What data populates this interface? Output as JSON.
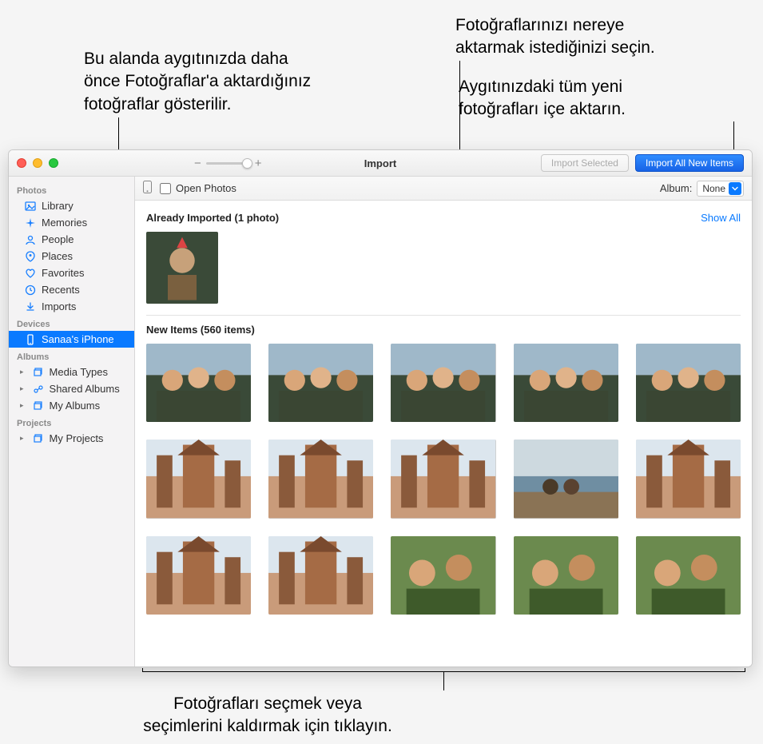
{
  "callouts": {
    "top_left": "Bu alanda aygıtınızda daha\nönce Fotoğraflar'a aktardığınız\nfotoğraflar gösterilir.",
    "top_right1": "Fotoğraflarınızı nereye\naktarmak istediğinizi seçin.",
    "top_right2": "Aygıtınızdaki tüm yeni\nfotoğrafları içe aktarın.",
    "bottom": "Fotoğrafları seçmek veya\nseçimlerini kaldırmak için tıklayın."
  },
  "toolbar": {
    "title": "Import",
    "zoom_minus": "−",
    "zoom_plus": "+",
    "import_selected": "Import Selected",
    "import_all": "Import All New Items"
  },
  "subbar": {
    "open_photos": "Open Photos",
    "album_label": "Album:",
    "album_value": "None"
  },
  "sidebar": {
    "sections": {
      "photos": "Photos",
      "devices": "Devices",
      "albums": "Albums",
      "projects": "Projects"
    },
    "photos": [
      {
        "icon": "photo",
        "label": "Library"
      },
      {
        "icon": "sparkle",
        "label": "Memories"
      },
      {
        "icon": "person",
        "label": "People"
      },
      {
        "icon": "pin",
        "label": "Places"
      },
      {
        "icon": "heart",
        "label": "Favorites"
      },
      {
        "icon": "clock",
        "label": "Recents"
      },
      {
        "icon": "download",
        "label": "Imports"
      }
    ],
    "devices": [
      {
        "icon": "phone",
        "label": "Sanaa's iPhone",
        "selected": true
      }
    ],
    "albums": [
      {
        "icon": "stack",
        "label": "Media Types",
        "chev": true
      },
      {
        "icon": "shared",
        "label": "Shared Albums",
        "chev": true
      },
      {
        "icon": "stack",
        "label": "My Albums",
        "chev": true
      }
    ],
    "projects_items": [
      {
        "icon": "stack",
        "label": "My Projects",
        "chev": true
      }
    ]
  },
  "sections": {
    "already": "Already Imported (1 photo)",
    "show_all": "Show All",
    "new_items": "New Items (560 items)"
  },
  "palettes": [
    "city",
    "temple",
    "water",
    "green"
  ]
}
